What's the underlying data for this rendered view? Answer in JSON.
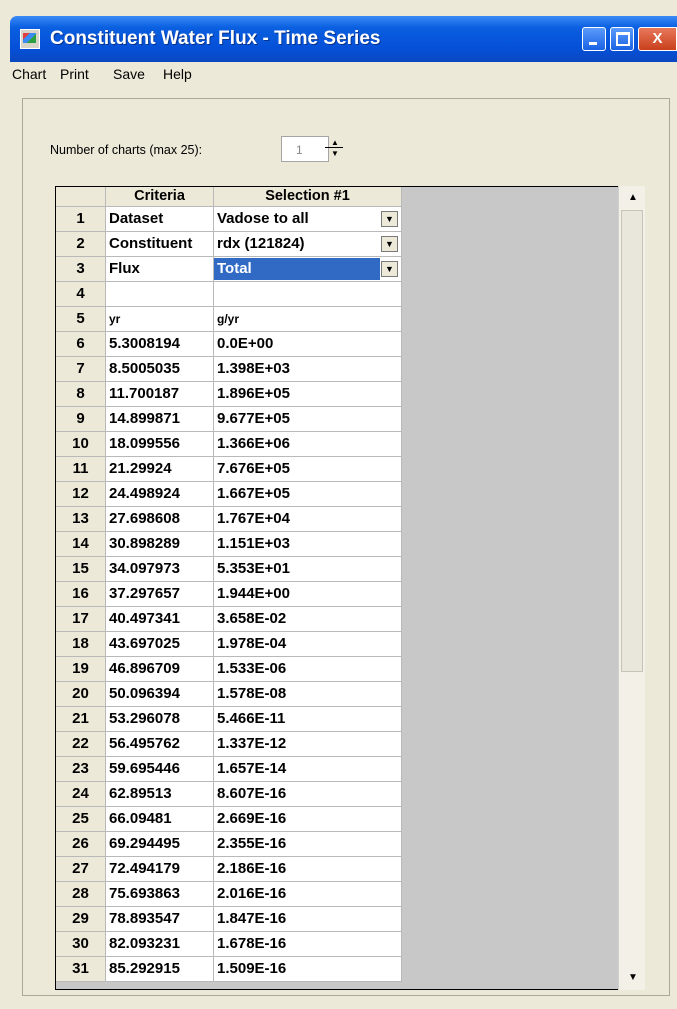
{
  "window": {
    "title": "Constituent Water Flux - Time Series",
    "controls": {
      "minimize": "minimize",
      "maximize": "maximize",
      "close": "X"
    }
  },
  "menu": [
    "Chart",
    "Print",
    "Save",
    "Help"
  ],
  "charts": {
    "label": "Number of charts (max 25):",
    "value": "1"
  },
  "grid": {
    "headers": {
      "a": "Criteria",
      "b": "Selection #1"
    },
    "criteria_rows": [
      {
        "num": "1",
        "a": "Dataset",
        "b": "Vadose to all"
      },
      {
        "num": "2",
        "a": "Constituent",
        "b": "rdx (121824)"
      },
      {
        "num": "3",
        "a": "Flux",
        "b": "Total"
      },
      {
        "num": "4",
        "a": "",
        "b": ""
      },
      {
        "num": "5",
        "a": "yr",
        "b": "g/yr"
      }
    ],
    "data_rows": [
      {
        "num": "6",
        "a": "5.3008194",
        "b": "0.0E+00"
      },
      {
        "num": "7",
        "a": "8.5005035",
        "b": "1.398E+03"
      },
      {
        "num": "8",
        "a": "11.700187",
        "b": "1.896E+05"
      },
      {
        "num": "9",
        "a": "14.899871",
        "b": "9.677E+05"
      },
      {
        "num": "10",
        "a": "18.099556",
        "b": "1.366E+06"
      },
      {
        "num": "11",
        "a": "21.29924",
        "b": "7.676E+05"
      },
      {
        "num": "12",
        "a": "24.498924",
        "b": "1.667E+05"
      },
      {
        "num": "13",
        "a": "27.698608",
        "b": "1.767E+04"
      },
      {
        "num": "14",
        "a": "30.898289",
        "b": "1.151E+03"
      },
      {
        "num": "15",
        "a": "34.097973",
        "b": "5.353E+01"
      },
      {
        "num": "16",
        "a": "37.297657",
        "b": "1.944E+00"
      },
      {
        "num": "17",
        "a": "40.497341",
        "b": "3.658E-02"
      },
      {
        "num": "18",
        "a": "43.697025",
        "b": "1.978E-04"
      },
      {
        "num": "19",
        "a": "46.896709",
        "b": "1.533E-06"
      },
      {
        "num": "20",
        "a": "50.096394",
        "b": "1.578E-08"
      },
      {
        "num": "21",
        "a": "53.296078",
        "b": "5.466E-11"
      },
      {
        "num": "22",
        "a": "56.495762",
        "b": "1.337E-12"
      },
      {
        "num": "23",
        "a": "59.695446",
        "b": "1.657E-14"
      },
      {
        "num": "24",
        "a": "62.89513",
        "b": "8.607E-16"
      },
      {
        "num": "25",
        "a": "66.09481",
        "b": "2.669E-16"
      },
      {
        "num": "26",
        "a": "69.294495",
        "b": "2.355E-16"
      },
      {
        "num": "27",
        "a": "72.494179",
        "b": "2.186E-16"
      },
      {
        "num": "28",
        "a": "75.693863",
        "b": "2.016E-16"
      },
      {
        "num": "29",
        "a": "78.893547",
        "b": "1.847E-16"
      },
      {
        "num": "30",
        "a": "82.093231",
        "b": "1.678E-16"
      },
      {
        "num": "31",
        "a": "85.292915",
        "b": "1.509E-16"
      }
    ]
  },
  "colors": {
    "titlebar": "#0550d8",
    "selection": "#316ac5",
    "window_bg": "#ece9d8"
  },
  "icons": {
    "app": "app-icon",
    "dropdown": "dropdown-arrow-icon",
    "scroll_up": "scroll-up-icon",
    "scroll_down": "scroll-down-icon"
  }
}
